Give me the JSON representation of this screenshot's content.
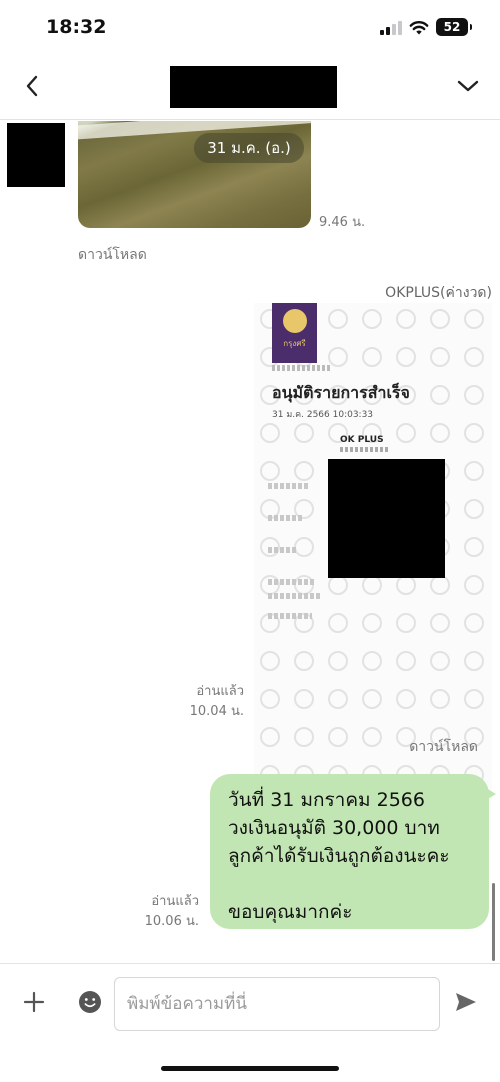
{
  "status_bar": {
    "time": "18:32",
    "battery": "52",
    "signal_icon": "cellular-signal-icon",
    "wifi_icon": "wifi-icon"
  },
  "header": {
    "back_icon": "chevron-left-icon",
    "expand_icon": "chevron-down-icon"
  },
  "messages": {
    "photo": {
      "date_overlay": "31 ม.ค. (อ.)",
      "time": "9.46 น.",
      "download": "ดาวน์โหลด"
    },
    "receipt": {
      "sender": "OKPLUS(ค่างวด)",
      "title": "อนุมัติรายการสำเร็จ",
      "subtitle": "31 ม.ค. 2566 10:03:33",
      "merchant": "OK PLUS",
      "read_status": "อ่านแล้ว",
      "time": "10.04 น.",
      "download": "ดาวน์โหลด"
    },
    "sent": {
      "lines": [
        "วันที่ 31 มกราคม 2566",
        "วงเงินอนุมัติ  30,000 บาท",
        "ลูกค้าได้รับเงินถูกต้องนะคะ",
        "",
        "ขอบคุณมากค่ะ"
      ],
      "read_status": "อ่านแล้ว",
      "time": "10.06 น."
    }
  },
  "input_bar": {
    "placeholder": "พิมพ์ข้อความที่นี่",
    "value": "",
    "plus_icon": "plus-icon",
    "emoji_icon": "emoji-icon",
    "send_icon": "send-icon"
  },
  "colors": {
    "sent_bubble": "#c2e6b3",
    "meta_text": "#777777",
    "brand_purple": "#4b2d6b"
  }
}
